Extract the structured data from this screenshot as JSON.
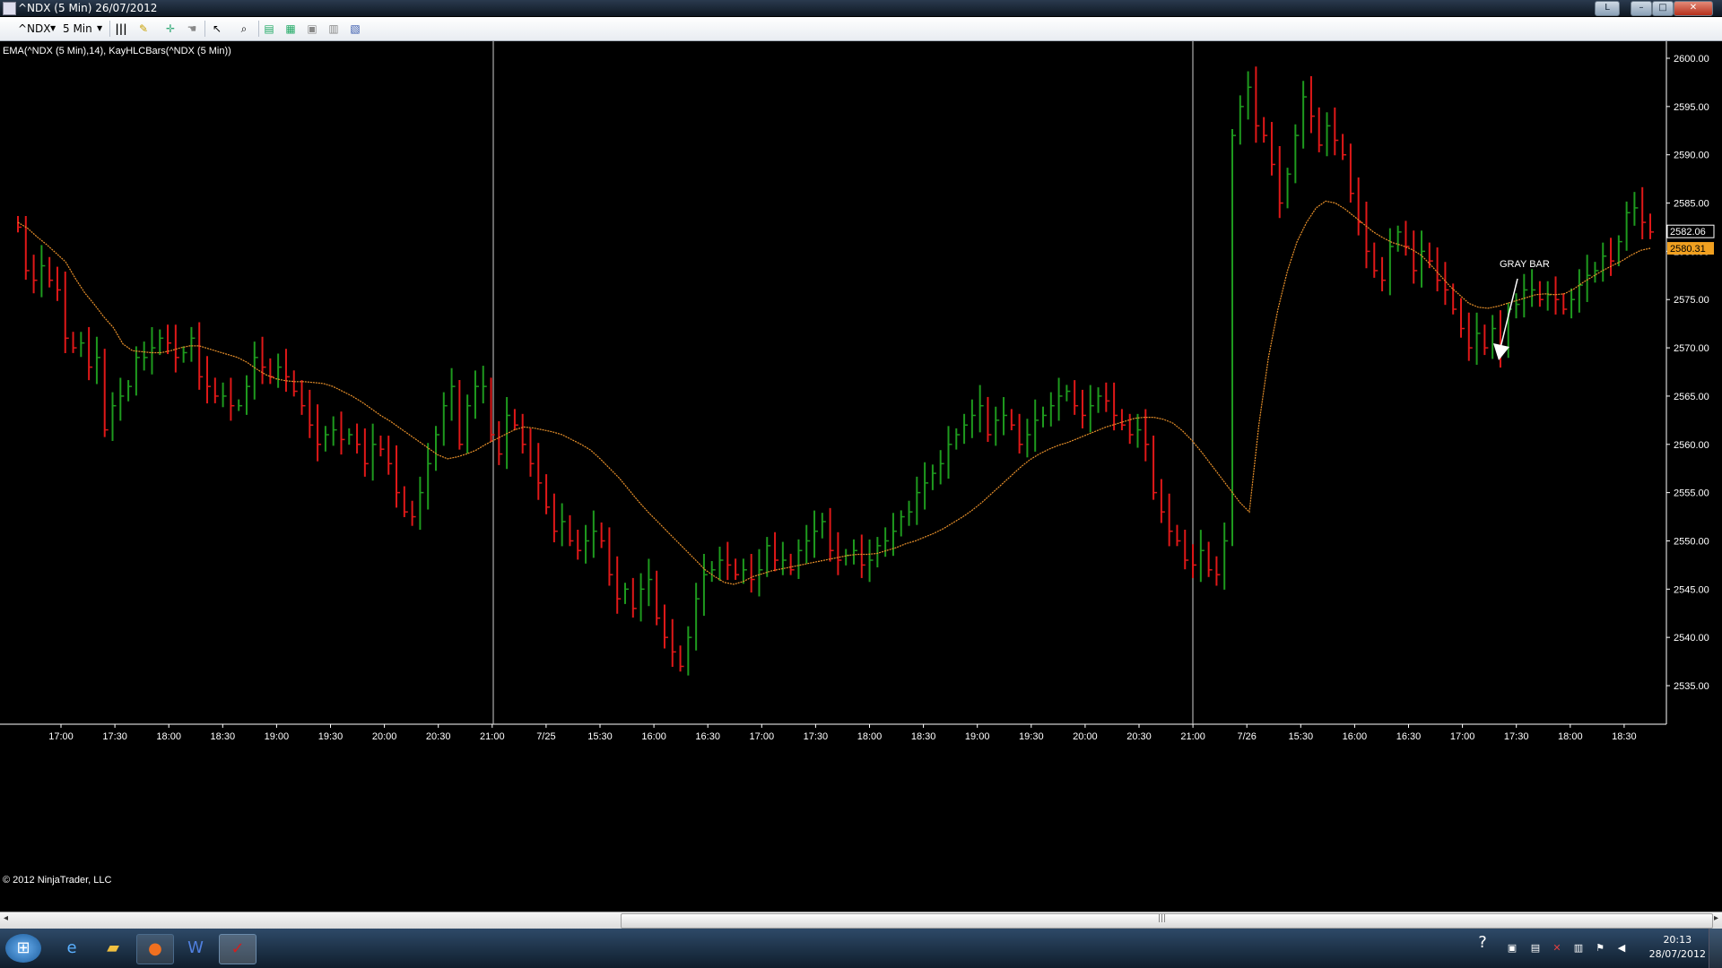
{
  "window": {
    "title": "^NDX (5 Min)  26/07/2012",
    "btn_l": "L",
    "btn_min": "–",
    "btn_max": "□",
    "btn_close": "✕"
  },
  "toolbar": {
    "instrument": "^NDX",
    "interval": "5 Min",
    "dropdown_icon": "chevron-down-icon"
  },
  "chart": {
    "indicator_label": "EMA(^NDX (5 Min),14), KayHLCBars(^NDX (5 Min))",
    "copyright": "© 2012 NinjaTrader, LLC",
    "annotation": "GRAY BAR",
    "last_price": "2582.06",
    "ema_value": "2580.31",
    "up_color": "#1e9a1e",
    "down_color": "#e01818",
    "ema_color": "#e8902a",
    "price_badge_color": "#ffffff",
    "ema_badge_color": "#f0a020"
  },
  "chart_data": {
    "type": "bar",
    "series": [
      {
        "name": "KayHLCBars(^NDX (5 Min))",
        "kind": "hlc",
        "close": [
          2582.5,
          2578,
          2577,
          2578.5,
          2577,
          2576,
          2571,
          2570,
          2570.5,
          2568,
          2569,
          2561.5,
          2564,
          2565,
          2566,
          2569,
          2569,
          2570,
          2571,
          2570.5,
          2569,
          2569.5,
          2571,
          2567,
          2566,
          2565,
          2565,
          2564,
          2564,
          2566,
          2569,
          2568,
          2567,
          2568,
          2567,
          2565.5,
          2564,
          2562,
          2560,
          2561,
          2561.5,
          2560.5,
          2561,
          2560,
          2558,
          2560,
          2559.5,
          2558,
          2555,
          2553,
          2552.5,
          2555,
          2558,
          2561,
          2564,
          2566,
          2560,
          2564,
          2566,
          2566,
          2561,
          2559,
          2563,
          2562,
          2560,
          2558,
          2556,
          2553.5,
          2551,
          2552,
          2550,
          2549,
          2550,
          2551,
          2550,
          2546.5,
          2544,
          2545,
          2543,
          2545,
          2546,
          2542,
          2540,
          2538.5,
          2537,
          2540,
          2544,
          2546.5,
          2547,
          2548,
          2547.5,
          2546.5,
          2547,
          2546,
          2547,
          2549.5,
          2548,
          2548,
          2547,
          2549,
          2550,
          2551,
          2552,
          2549,
          2548,
          2548.5,
          2549,
          2547.5,
          2548,
          2549.5,
          2550,
          2551,
          2552.5,
          2553,
          2555,
          2556,
          2557,
          2558,
          2560,
          2561,
          2562,
          2563,
          2564,
          2561,
          2562.5,
          2563,
          2562,
          2560,
          2561,
          2562.5,
          2563,
          2564,
          2565,
          2565.5,
          2564,
          2563,
          2564,
          2565,
          2564.5,
          2563,
          2562,
          2561,
          2561.5,
          2560,
          2555,
          2553,
          2551,
          2550,
          2548,
          2547.5,
          2549,
          2547,
          2546.5,
          2550,
          2592,
          2595,
          2597,
          2593,
          2592,
          2589,
          2585,
          2588,
          2592,
          2596,
          2594,
          2591,
          2593,
          2591.5,
          2590,
          2586,
          2583,
          2580,
          2578,
          2577,
          2580.5,
          2582,
          2580.5,
          2578,
          2580,
          2579,
          2577,
          2576,
          2574,
          2572,
          2570,
          2571.5,
          2570,
          2572,
          2569.5,
          2574,
          2574.5,
          2576,
          2576,
          2575,
          2575.5,
          2575,
          2574,
          2575,
          2576.5,
          2577.5,
          2578,
          2579.5,
          2579,
          2581,
          2584,
          2584.5,
          2583,
          2582
        ]
      },
      {
        "name": "EMA(^NDX (5 Min),14)",
        "kind": "line",
        "values": [
          2583,
          2582.4,
          2581.5,
          2580.7,
          2579.8,
          2578.9,
          2577.2,
          2575.7,
          2574.5,
          2573.2,
          2572.1,
          2570.4,
          2569.7,
          2569.6,
          2569.5,
          2569.5,
          2569.7,
          2570.0,
          2570.2,
          2570.2,
          2569.9,
          2569.6,
          2569.3,
          2569.0,
          2568.5,
          2567.8,
          2567.2,
          2566.8,
          2566.6,
          2566.5,
          2566.5,
          2566.4,
          2566.3,
          2566.0,
          2565.5,
          2565.0,
          2564.4,
          2563.7,
          2563.0,
          2562.4,
          2561.7,
          2561.0,
          2560.3,
          2559.6,
          2558.9,
          2558.5,
          2558.7,
          2559.0,
          2559.4,
          2560.0,
          2560.5,
          2561.0,
          2561.5,
          2561.8,
          2561.7,
          2561.5,
          2561.3,
          2561.0,
          2560.5,
          2560.0,
          2559.4,
          2558.5,
          2557.5,
          2556.5,
          2555.3,
          2554.1,
          2553.0,
          2552.0,
          2551.0,
          2550.0,
          2549.0,
          2548.0,
          2547.0,
          2546.3,
          2545.7,
          2545.5,
          2545.8,
          2546.3,
          2546.6,
          2546.9,
          2547.1,
          2547.3,
          2547.5,
          2547.7,
          2547.9,
          2548.1,
          2548.3,
          2548.5,
          2548.6,
          2548.6,
          2548.7,
          2549.0,
          2549.3,
          2549.7,
          2550.0,
          2550.4,
          2550.8,
          2551.3,
          2551.9,
          2552.5,
          2553.2,
          2554.0,
          2554.9,
          2555.8,
          2556.7,
          2557.6,
          2558.4,
          2559.0,
          2559.5,
          2559.9,
          2560.2,
          2560.6,
          2561.0,
          2561.4,
          2561.8,
          2562.1,
          2562.4,
          2562.7,
          2562.8,
          2562.8,
          2562.6,
          2562.2,
          2561.4,
          2560.4,
          2559.2,
          2557.9,
          2556.6,
          2555.3,
          2554.0,
          2553.0,
          2562.0,
          2569.0,
          2574.0,
          2578.0,
          2581.0,
          2583.0,
          2584.5,
          2585.2,
          2585.0,
          2584.4,
          2583.6,
          2582.8,
          2582.0,
          2581.4,
          2580.9,
          2580.6,
          2580.2,
          2579.6,
          2578.6,
          2577.5,
          2576.4,
          2575.5,
          2574.6,
          2574.2,
          2574.1,
          2574.3,
          2574.6,
          2574.9,
          2575.2,
          2575.5,
          2575.6,
          2575.5,
          2575.6,
          2576.1,
          2576.8,
          2577.4,
          2578.0,
          2578.5,
          2579.0,
          2579.6,
          2580.1,
          2580.31
        ]
      }
    ],
    "ylim": [
      2533,
      2601
    ],
    "yticks": [
      "2600.00",
      "2595.00",
      "2590.00",
      "2585.00",
      "2580.00",
      "2575.00",
      "2570.00",
      "2565.00",
      "2560.00",
      "2555.00",
      "2550.00",
      "2545.00",
      "2540.00",
      "2535.00"
    ],
    "xticks": [
      "17:00",
      "17:30",
      "18:00",
      "18:30",
      "19:00",
      "19:30",
      "20:00",
      "20:30",
      "21:00",
      "7/25",
      "15:30",
      "16:00",
      "16:30",
      "17:00",
      "17:30",
      "18:00",
      "18:30",
      "19:00",
      "19:30",
      "20:00",
      "20:30",
      "21:00",
      "7/26",
      "15:30",
      "16:00",
      "16:30",
      "17:00",
      "17:30",
      "18:00",
      "18:30"
    ],
    "session_breaks": [
      "21:00",
      "21:00"
    ]
  },
  "taskbar": {
    "clock_time": "20:13",
    "clock_date": "28/07/2012",
    "icons": [
      "start-orb-icon",
      "internet-explorer-icon",
      "folder-icon",
      "firefox-icon",
      "word-icon",
      "ninjatrader-icon"
    ]
  }
}
